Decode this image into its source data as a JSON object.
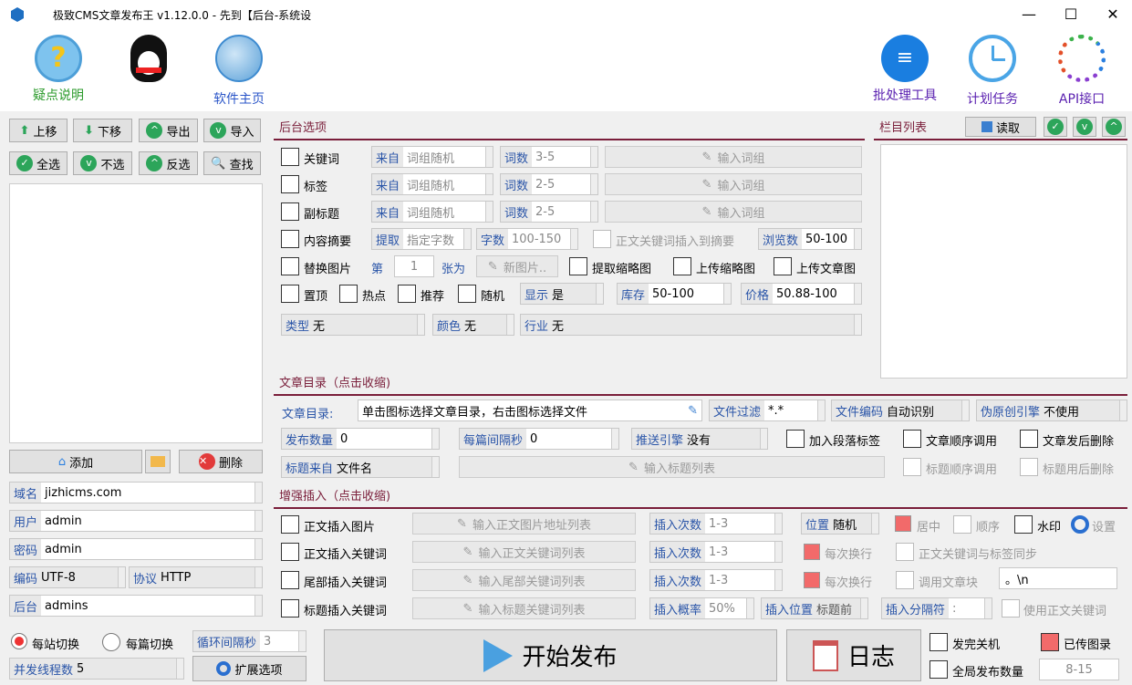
{
  "window": {
    "title": "极致CMS文章发布王 v1.12.0.0 - 先到【后台-系统设",
    "minimize": "—",
    "maximize": "☐",
    "close": "✕"
  },
  "toolbar": {
    "help": "疑点说明",
    "home": "软件主页",
    "batch": "批处理工具",
    "schedule": "计划任务",
    "api": "API接口"
  },
  "left": {
    "up": "上移",
    "down": "下移",
    "export": "导出",
    "import": "导入",
    "select_all": "全选",
    "select_none": "不选",
    "invert": "反选",
    "find": "查找",
    "add": "添加",
    "delete": "删除",
    "domain_k": "域名",
    "domain_v": "jizhicms.com",
    "user_k": "用户",
    "user_v": "admin",
    "pass_k": "密码",
    "pass_v": "admin",
    "enc_k": "编码",
    "enc_v": "UTF-8",
    "proto_k": "协议",
    "proto_v": "HTTP",
    "backend_k": "后台",
    "backend_v": "admins"
  },
  "backend_opts": {
    "title": "后台选项",
    "keyword": "关键词",
    "tag": "标签",
    "subtitle": "副标题",
    "summary": "内容摘要",
    "replace_img": "替换图片",
    "top": "置顶",
    "hot": "热点",
    "recommend": "推荐",
    "random": "随机",
    "src_k": "来自",
    "src_v": "词组随机",
    "count_k": "词数",
    "count1": "3-5",
    "count2": "2-5",
    "count3": "2-5",
    "input_words": "输入词组",
    "extract_k": "提取",
    "extract_v": "指定字数",
    "chars_k": "字数",
    "chars_v": "100-150",
    "insert_summary": "正文关键词插入到摘要",
    "views_k": "浏览数",
    "views_v": "50-100",
    "nth": "第",
    "nth_v": "1",
    "zhang": "张为",
    "new_img": "新图片..",
    "thumb": "提取缩略图",
    "upload_thumb": "上传缩略图",
    "upload_img": "上传文章图",
    "show_k": "显示",
    "show_v": "是",
    "stock_k": "库存",
    "stock_v": "50-100",
    "price_k": "价格",
    "price_v": "50.88-100",
    "type_k": "类型",
    "type_v": "无",
    "color_k": "颜色",
    "color_v": "无",
    "industry_k": "行业",
    "industry_v": "无"
  },
  "columns": {
    "title": "栏目列表",
    "read": "读取"
  },
  "catalog": {
    "title": "文章目录（点击收缩)",
    "dir_k": "文章目录:",
    "dir_v": "单击图标选择文章目录，右击图标选择文件",
    "filter_k": "文件过滤",
    "filter_v": "*.*",
    "enc_k": "文件编码",
    "enc_v": "自动识别",
    "pseudo_k": "伪原创引擎",
    "pseudo_v": "不使用",
    "pubcount_k": "发布数量",
    "pubcount_v": "0",
    "interval_k": "每篇间隔秒",
    "interval_v": "0",
    "push_k": "推送引擎",
    "push_v": "没有",
    "add_para": "加入段落标签",
    "order_call": "文章顺序调用",
    "del_after": "文章发后删除",
    "titlesrc_k": "标题来自",
    "titlesrc_v": "文件名",
    "title_list": "输入标题列表",
    "title_order": "标题顺序调用",
    "title_del": "标题用后删除"
  },
  "enhance": {
    "title": "增强插入（点击收缩)",
    "ins_img": "正文插入图片",
    "ins_kw": "正文插入关键词",
    "tail_kw": "尾部插入关键词",
    "title_kw": "标题插入关键词",
    "img_list": "输入正文图片地址列表",
    "kw_list": "输入正文关键词列表",
    "tail_list": "输入尾部关键词列表",
    "title_list": "输入标题关键词列表",
    "times_k": "插入次数",
    "times_v": "1-3",
    "prob_k": "插入概率",
    "prob_v": "50%",
    "pos_k": "位置",
    "pos_v": "随机",
    "inspos_k": "插入位置",
    "inspos_v": "标题前",
    "sep_k": "插入分隔符",
    "sep_v": ":",
    "center": "居中",
    "order": "顺序",
    "watermark": "水印",
    "settings": "设置",
    "each_line": "每次换行",
    "kw_tag_sync": "正文关键词与标签同步",
    "call_block": "调用文章块",
    "block_v": "。\\n",
    "use_kw": "使用正文关键词"
  },
  "bottom": {
    "per_site": "每站切换",
    "per_article": "每篇切换",
    "loop_k": "循环间隔秒",
    "loop_v": "3",
    "threads_k": "并发线程数",
    "threads_v": "5",
    "ext": "扩展选项",
    "start": "开始发布",
    "log": "日志",
    "shutdown": "发完关机",
    "uploaded": "已传图录",
    "global_count": "全局发布数量",
    "global_v": "8-15"
  }
}
